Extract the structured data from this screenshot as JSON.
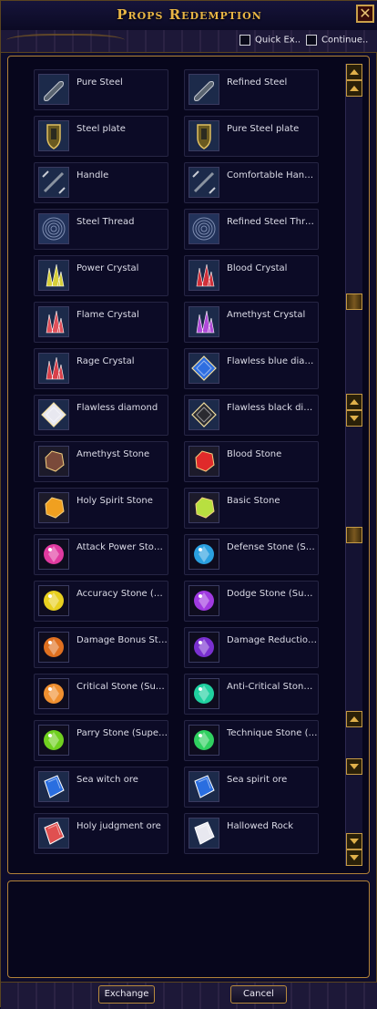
{
  "window": {
    "title": "Props Redemption",
    "close_label": "✕"
  },
  "options": [
    {
      "label": "Quick Ex..",
      "checked": false
    },
    {
      "label": "Continue..",
      "checked": false
    }
  ],
  "items": [
    {
      "name": "Pure Steel",
      "icon": "steel-ingot-icon"
    },
    {
      "name": "Refined Steel",
      "icon": "steel-ingot-icon"
    },
    {
      "name": "Steel plate",
      "icon": "shield-icon"
    },
    {
      "name": "Pure Steel plate",
      "icon": "shield-icon"
    },
    {
      "name": "Handle",
      "icon": "handle-icon"
    },
    {
      "name": "Comfortable Handle",
      "icon": "handle-icon"
    },
    {
      "name": "Steel Thread",
      "icon": "thread-coil-icon"
    },
    {
      "name": "Refined Steel Thread",
      "icon": "thread-coil-icon"
    },
    {
      "name": "Power Crystal",
      "icon": "crystal-icon",
      "color": "#d6cf3a"
    },
    {
      "name": "Blood Crystal",
      "icon": "crystal-icon",
      "color": "#d0303a"
    },
    {
      "name": "Flame Crystal",
      "icon": "crystal-icon",
      "color": "#e0505a"
    },
    {
      "name": "Amethyst Crystal",
      "icon": "crystal-icon",
      "color": "#b04ad8"
    },
    {
      "name": "Rage Crystal",
      "icon": "crystal-icon",
      "color": "#d8404a"
    },
    {
      "name": "Flawless blue diamond",
      "icon": "diamond-icon",
      "color": "#2e6ee0"
    },
    {
      "name": "Flawless diamond",
      "icon": "diamond-icon",
      "color": "#e8e8f0"
    },
    {
      "name": "Flawless black diamond",
      "icon": "diamond-icon",
      "color": "#2a2a30"
    },
    {
      "name": "Amethyst Stone",
      "icon": "stone-icon",
      "color": "#7a4a3a"
    },
    {
      "name": "Blood Stone",
      "icon": "stone-icon",
      "color": "#e02a2a"
    },
    {
      "name": "Holy Spirit Stone",
      "icon": "stone-icon",
      "color": "#f0a020"
    },
    {
      "name": "Basic Stone",
      "icon": "stone-icon",
      "color": "#b8e040"
    },
    {
      "name": "Attack Power Stone (Superior)",
      "icon": "gem-icon",
      "color": "#e03aa0"
    },
    {
      "name": "Defense Stone (Superior)",
      "icon": "gem-icon",
      "color": "#2aa0e0"
    },
    {
      "name": "Accuracy Stone (Superior)",
      "icon": "gem-icon",
      "color": "#e8d020"
    },
    {
      "name": "Dodge Stone (Superior)",
      "icon": "gem-icon",
      "color": "#a03ae0"
    },
    {
      "name": "Damage Bonus Stone (Superior)",
      "icon": "gem-icon",
      "color": "#e07020"
    },
    {
      "name": "Damage Reduction Stone (Superior)",
      "icon": "gem-icon",
      "color": "#7a30d0"
    },
    {
      "name": "Critical Stone (Superior)",
      "icon": "gem-icon",
      "color": "#f09030"
    },
    {
      "name": "Anti-Critical Stone (Superior)",
      "icon": "gem-icon",
      "color": "#20d0a0"
    },
    {
      "name": "Parry Stone (Superior)",
      "icon": "gem-icon",
      "color": "#70d020"
    },
    {
      "name": "Technique Stone (Superior)",
      "icon": "gem-icon",
      "color": "#30d060"
    },
    {
      "name": "Sea witch ore",
      "icon": "ore-icon",
      "color": "#2a6ee0"
    },
    {
      "name": "Sea spirit ore",
      "icon": "ore-icon",
      "color": "#2a6ee0"
    },
    {
      "name": "Holy judgment ore",
      "icon": "ore-icon",
      "color": "#e05050"
    },
    {
      "name": "Hallowed Rock",
      "icon": "ore-icon",
      "color": "#e8e8f0"
    }
  ],
  "scrollbar_icons": [
    "scroll-up-icon",
    "scroll-down-icon"
  ],
  "buttons": {
    "exchange": "Exchange",
    "cancel": "Cancel"
  },
  "colors": {
    "accent": "#e8b545",
    "frame": "#b28238",
    "background": "#07061c"
  }
}
